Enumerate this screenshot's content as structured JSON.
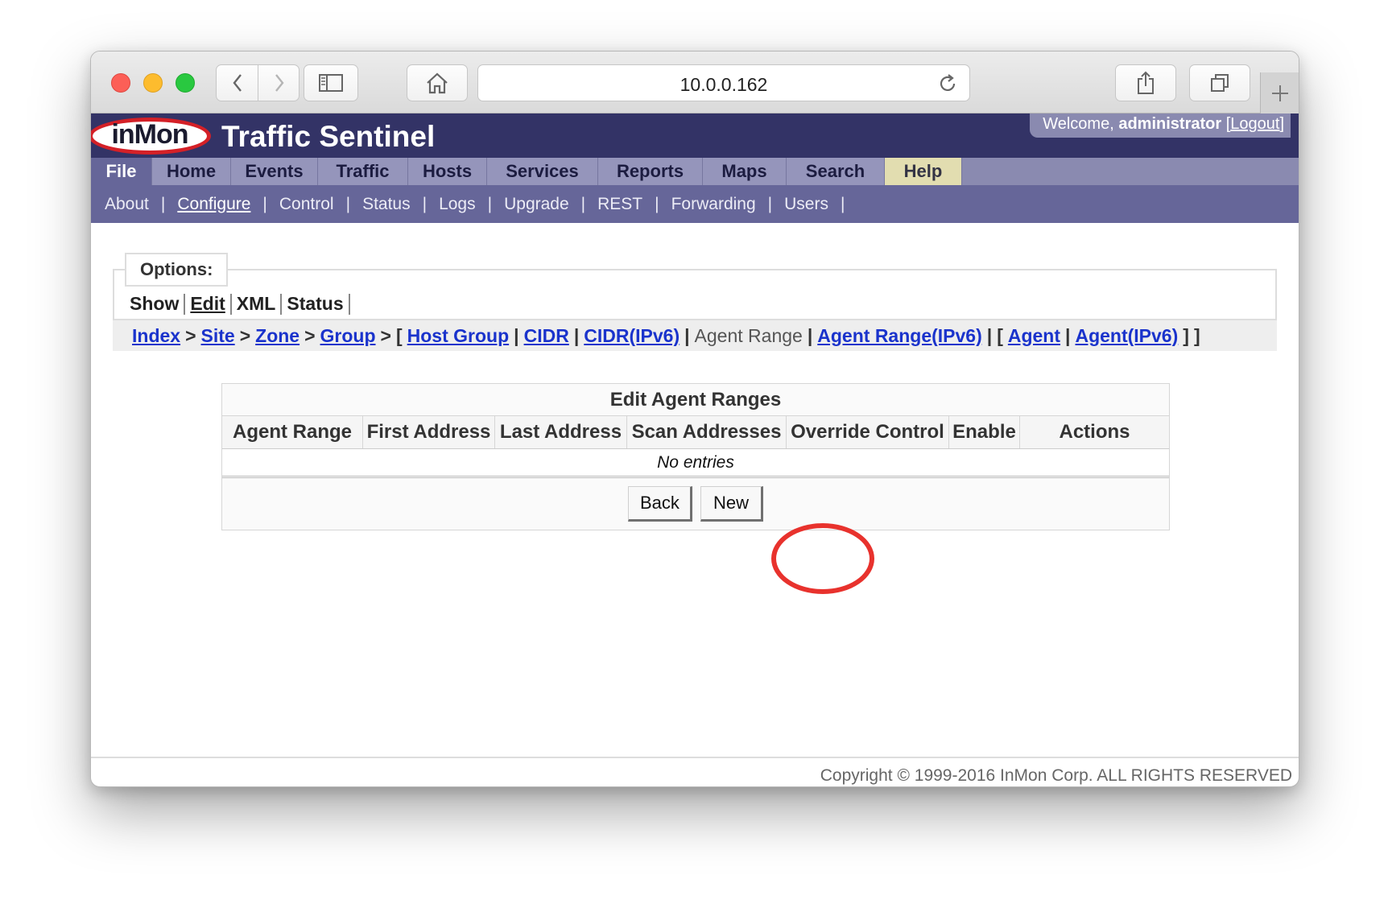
{
  "browser": {
    "url": "10.0.0.162"
  },
  "header": {
    "logo_text": "inMon",
    "app_title": "Traffic Sentinel",
    "welcome_prefix": "Welcome,",
    "user": "administrator",
    "logout_label": "Logout"
  },
  "menu": {
    "items": [
      {
        "label": "File",
        "width": 76
      },
      {
        "label": "Home",
        "width": 98
      },
      {
        "label": "Events",
        "width": 108
      },
      {
        "label": "Traffic",
        "width": 112
      },
      {
        "label": "Hosts",
        "width": 98
      },
      {
        "label": "Services",
        "width": 138
      },
      {
        "label": "Reports",
        "width": 130
      },
      {
        "label": "Maps",
        "width": 104
      },
      {
        "label": "Search",
        "width": 122
      },
      {
        "label": "Help",
        "width": 96
      }
    ],
    "active": "File"
  },
  "submenu": {
    "items": [
      "About",
      "Configure",
      "Control",
      "Status",
      "Logs",
      "Upgrade",
      "REST",
      "Forwarding",
      "Users"
    ],
    "active": "Configure"
  },
  "options": {
    "legend": "Options:",
    "items": [
      "Show",
      "Edit",
      "XML",
      "Status"
    ],
    "active": "Edit"
  },
  "breadcrumb": {
    "index": "Index",
    "site": "Site",
    "zone": "Zone",
    "group": "Group",
    "host_group": "Host Group",
    "cidr": "CIDR",
    "cidr_ipv6": "CIDR(IPv6)",
    "agent_range": "Agent Range",
    "agent_range_ipv6": "Agent Range(IPv6)",
    "agent": "Agent",
    "agent_ipv6": "Agent(IPv6)",
    "gt": ">",
    "open": "[",
    "close": "]",
    "pipe": "|"
  },
  "table": {
    "caption": "Edit Agent Ranges",
    "columns": [
      "Agent Range",
      "First Address",
      "Last Address",
      "Scan Addresses",
      "Override Control",
      "Enable",
      "Actions"
    ],
    "empty_text": "No entries",
    "back_label": "Back",
    "new_label": "New"
  },
  "footer": {
    "copyright": "Copyright © 1999-2016 InMon Corp. ALL RIGHTS RESERVED"
  },
  "colors": {
    "header_bg": "#333366",
    "menu_bg": "#8a8ab0",
    "submenu_bg": "#666699",
    "link": "#1a33cc",
    "annotation": "#e8322d"
  }
}
